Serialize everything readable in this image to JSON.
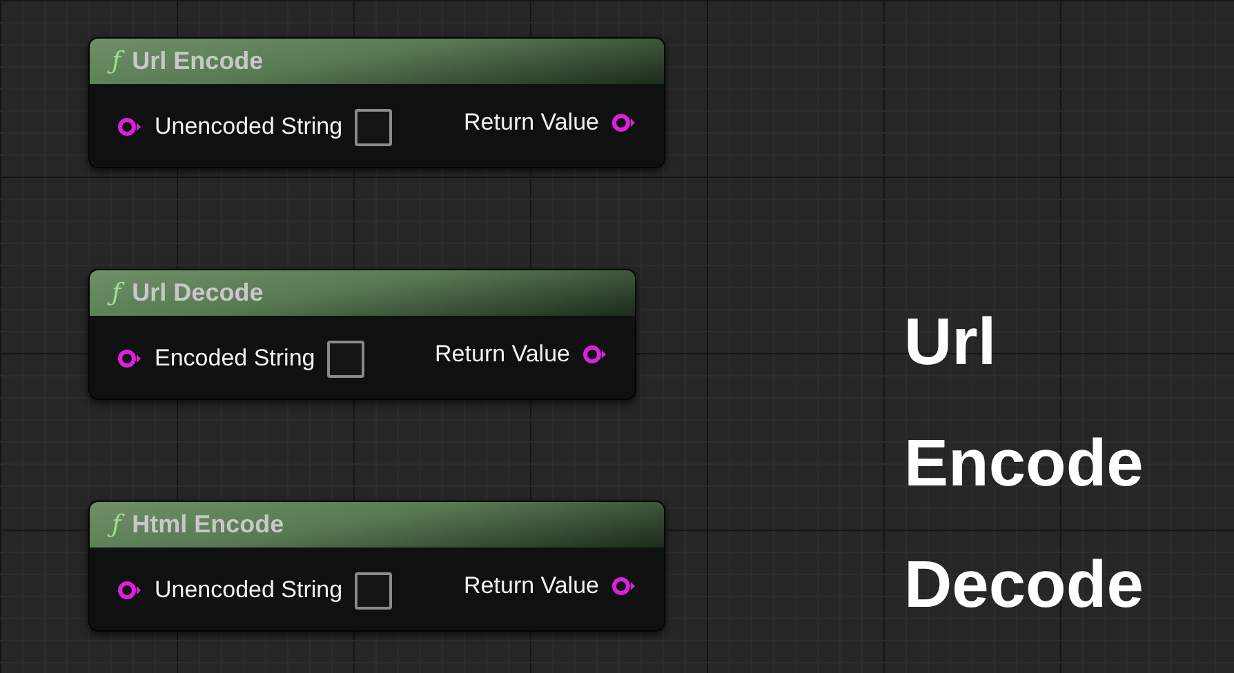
{
  "nodes": [
    {
      "icon": "ƒ",
      "title": "Url Encode",
      "input": "Unencoded String",
      "output": "Return Value"
    },
    {
      "icon": "ƒ",
      "title": "Url Decode",
      "input": "Encoded String",
      "output": "Return Value"
    },
    {
      "icon": "ƒ",
      "title": "Html Encode",
      "input": "Unencoded String",
      "output": "Return Value"
    }
  ],
  "caption": [
    "Url",
    "Encode",
    "Decode"
  ]
}
